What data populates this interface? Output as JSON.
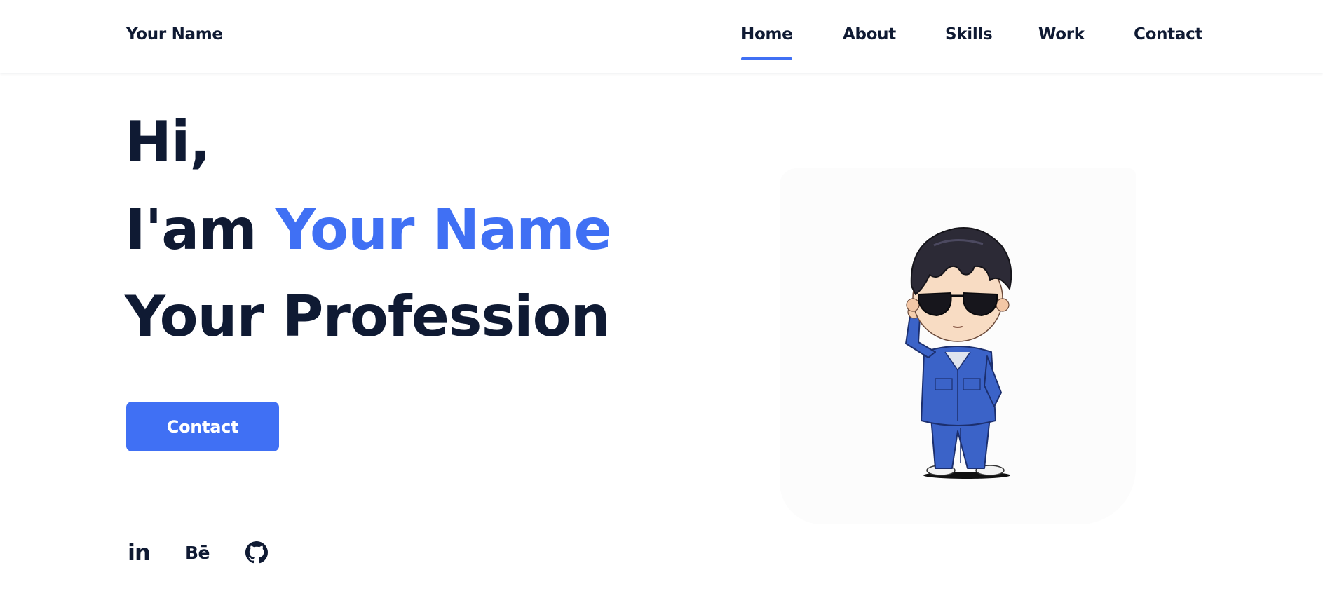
{
  "header": {
    "brand": "Your Name",
    "nav": [
      {
        "label": "Home",
        "active": true
      },
      {
        "label": "About",
        "active": false
      },
      {
        "label": "Skills",
        "active": false
      },
      {
        "label": "Work",
        "active": false
      },
      {
        "label": "Contact",
        "active": false
      }
    ]
  },
  "hero": {
    "greeting": "Hi,",
    "intro_prefix": "I'am",
    "name": "Your Name",
    "profession": "Your Profession",
    "button_label": "Contact",
    "image_icon": "chibi-character-illustration"
  },
  "social": [
    {
      "label": "in",
      "icon": "linkedin-icon"
    },
    {
      "label": "Bē",
      "icon": "behance-icon"
    },
    {
      "label": "",
      "icon": "github-icon"
    }
  ],
  "colors": {
    "accent": "#4070f4",
    "text": "#0f1a33",
    "background": "#ffffff"
  }
}
